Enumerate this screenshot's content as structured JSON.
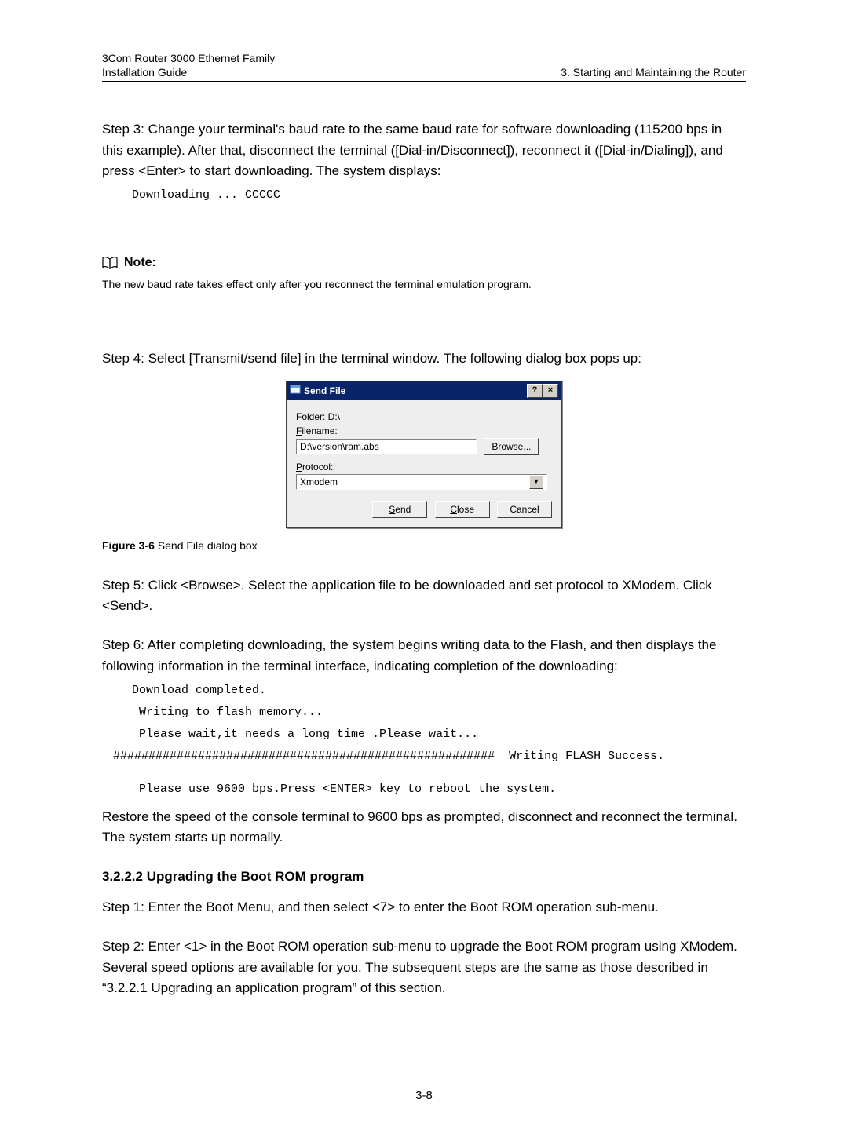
{
  "header": {
    "left_line1": "3Com Router 3000 Ethernet Family",
    "left_line2": "Installation Guide",
    "right": "3. Starting and Maintaining the Router"
  },
  "para_step3": "Step 3: Change your terminal's baud rate to the same baud rate for software downloading (115200 bps in this example).  After that, disconnect the terminal ([Dial-in/Disconnect]), reconnect it ([Dial-in/Dialing]), and press <Enter> to start downloading. The system displays:",
  "mono_download": "Downloading ... CCCCC",
  "note": {
    "title": "Note:",
    "text": "The new baud rate takes effect only after you reconnect the terminal emulation program."
  },
  "para_step4": "Step 4: Select [Transmit/send file] in the terminal window. The following dialog box pops up:",
  "dialog": {
    "title": "Send File",
    "help_glyph": "?",
    "close_glyph": "×",
    "folder_label": "Folder: D:\\",
    "filename_label": "Filename:",
    "filename_value": "D:\\version\\ram.abs",
    "browse_btn": "Browse...",
    "protocol_label": "Protocol:",
    "protocol_value": "Xmodem",
    "send_btn": "Send",
    "close_btn": "Close",
    "cancel_btn": "Cancel",
    "dd_glyph": "▼"
  },
  "figcap_num": "Figure 3-6",
  "figcap_text": " Send File dialog box",
  "para_step5": "Step 5: Click <Browse>. Select the application file to be downloaded and set protocol to XModem. Click <Send>.",
  "para_step6": "Step 6: After completing downloading, the system begins writing data to the Flash, and then displays the following information in the terminal interface, indicating completion of the downloading:",
  "mono_block2_l1": "Download completed.",
  "mono_block2_l2": " Writing to flash memory...",
  "mono_block2_l3": " Please wait,it needs a long time .Please wait...",
  "mono_block2_l4": "######################################################  Writing FLASH Success.",
  "mono_block2_l5": " Please use 9600 bps.Press <ENTER> key to reboot the system.",
  "para_restore": "Restore the speed of the console terminal to 9600 bps as prompted, disconnect and reconnect the terminal. The system starts up normally.",
  "h4": "3.2.2.2 Upgrading the Boot ROM program",
  "para_s1": "Step 1: Enter the Boot Menu, and then select <7> to enter the Boot ROM operation sub-menu.",
  "para_s2": "Step 2: Enter <1> in the Boot ROM operation sub-menu to upgrade the Boot ROM program using XModem. Several speed options are available for you. The subsequent steps are the same as those described in “3.2.2.1 Upgrading an application program” of this section.",
  "pagenum": "3-8"
}
